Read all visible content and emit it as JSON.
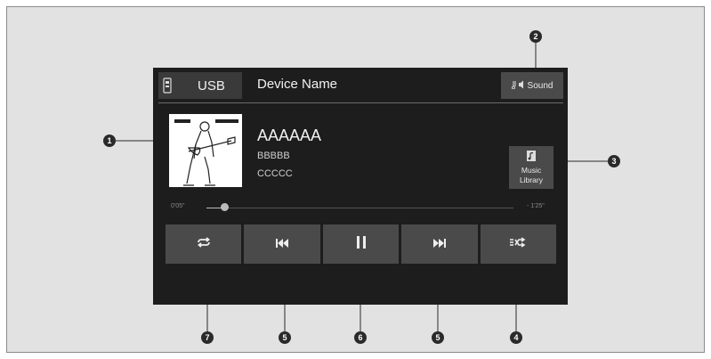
{
  "header": {
    "source_label": "USB",
    "device_name": "Device Name",
    "sound_label": "Sound"
  },
  "track": {
    "title": "AAAAAA",
    "artist": "BBBBB",
    "album": "CCCCC"
  },
  "progress": {
    "elapsed": "0'05\"",
    "remaining": "- 1'25\"",
    "fraction": 0.06
  },
  "library": {
    "line1": "Music",
    "line2": "Library"
  },
  "controls": [
    {
      "name": "repeat",
      "icon": "repeat-icon"
    },
    {
      "name": "previous",
      "icon": "skip-back-icon"
    },
    {
      "name": "play-pause",
      "icon": "pause-icon"
    },
    {
      "name": "next",
      "icon": "skip-forward-icon"
    },
    {
      "name": "shuffle",
      "icon": "shuffle-icon"
    }
  ],
  "callouts": [
    "1",
    "2",
    "3",
    "7",
    "5",
    "6",
    "5",
    "4"
  ],
  "colors": {
    "screen_bg": "#1d1d1d",
    "button_bg": "#4a4a4a",
    "frame_bg": "#e2e2e2"
  }
}
